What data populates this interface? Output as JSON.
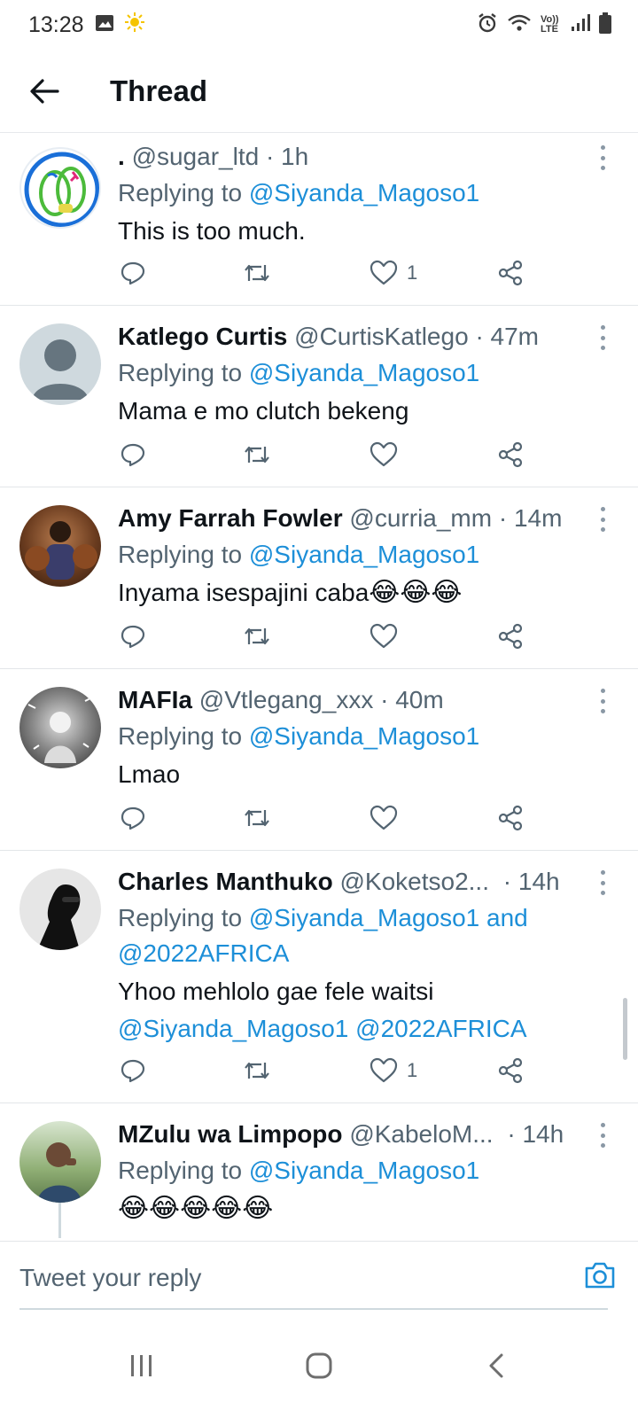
{
  "status_bar": {
    "time": "13:28",
    "network": "Vo)) LTE"
  },
  "header": {
    "title": "Thread"
  },
  "colors": {
    "link": "#1d8fd8",
    "text": "#0f1419",
    "secondary": "#536471"
  },
  "tweets": [
    {
      "display_name": ".",
      "handle": "@sugar_ltd",
      "time": "· 1h",
      "replying_prefix": "Replying to ",
      "replying_to": "@Siyanda_Magoso1",
      "replying_and": "",
      "replying_to_2": "",
      "text": "This is too much.",
      "text_mention_1": "",
      "text_mention_2": "",
      "like_count": "1"
    },
    {
      "display_name": "Katlego Curtis",
      "handle": "@CurtisKatlego",
      "time": "· 47m",
      "replying_prefix": "Replying to ",
      "replying_to": "@Siyanda_Magoso1",
      "text": "Mama e mo clutch bekeng",
      "like_count": ""
    },
    {
      "display_name": "Amy Farrah Fowler",
      "handle": "@curria_mm",
      "time": "· 14m",
      "replying_prefix": "Replying to ",
      "replying_to": "@Siyanda_Magoso1",
      "text": "Inyama isespajini caba",
      "text_emoji": "😂😂😂",
      "like_count": ""
    },
    {
      "display_name": "MAFIa",
      "handle": "@Vtlegang_xxx",
      "time": "· 40m",
      "replying_prefix": "Replying to ",
      "replying_to": "@Siyanda_Magoso1",
      "text": "Lmao",
      "like_count": ""
    },
    {
      "display_name": "Charles Manthuko",
      "handle": "@Koketso2...",
      "time": "· 14h",
      "replying_prefix": "Replying to ",
      "replying_to": "@Siyanda_Magoso1",
      "replying_and": " and",
      "replying_to_2": "@2022AFRICA",
      "text": "Yhoo mehlolo gae fele waitsi",
      "text_mention_1": "@Siyanda_Magoso1",
      "text_mention_2": "@2022AFRICA",
      "like_count": "1"
    },
    {
      "display_name": "MZulu wa Limpopo",
      "handle": "@KabeloM...",
      "time": "· 14h",
      "replying_prefix": "Replying to ",
      "replying_to": "@Siyanda_Magoso1",
      "text_emoji": "😂😂😂😂😂"
    }
  ],
  "composer": {
    "placeholder": "Tweet your reply"
  }
}
